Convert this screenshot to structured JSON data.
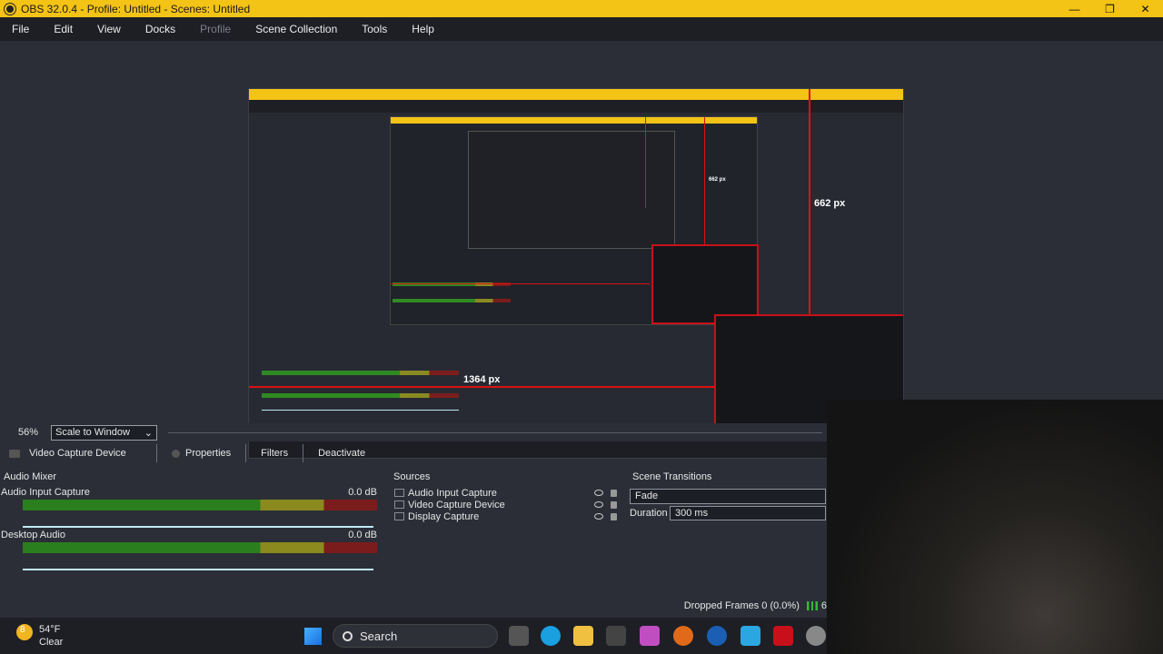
{
  "window": {
    "title": "OBS 32.0.4 - Profile: Untitled - Scenes: Untitled",
    "minimize": "—",
    "maximize": "❐",
    "close": "✕"
  },
  "menu": [
    "File",
    "Edit",
    "View",
    "Docks",
    "Profile",
    "Scene Collection",
    "Tools",
    "Help"
  ],
  "preview": {
    "height_label": "662 px",
    "width_label": "1364 px",
    "mini_height_label": "662 px"
  },
  "scale": {
    "zoom": "56%",
    "mode": "Scale to Window"
  },
  "source_toolbar": {
    "source": "Video Capture Device",
    "properties": "Properties",
    "filters": "Filters",
    "deactivate": "Deactivate"
  },
  "audio_mixer": {
    "title": "Audio Mixer",
    "channels": [
      {
        "name": "Audio Input Capture",
        "db": "0.0 dB"
      },
      {
        "name": "Desktop Audio",
        "db": "0.0 dB"
      }
    ]
  },
  "sources": {
    "title": "Sources",
    "items": [
      "Audio Input Capture",
      "Video Capture Device",
      "Display Capture"
    ]
  },
  "scene_transitions": {
    "title": "Scene Transitions",
    "transition": "Fade",
    "duration_label": "Duration",
    "duration": "300 ms"
  },
  "status": {
    "dropped_frames": "Dropped Frames 0 (0.0%)",
    "fps_partial": "6"
  },
  "taskbar": {
    "weather_temp": "54°F",
    "weather_cond": "Clear",
    "weather_badge": "8",
    "search": "Search"
  }
}
